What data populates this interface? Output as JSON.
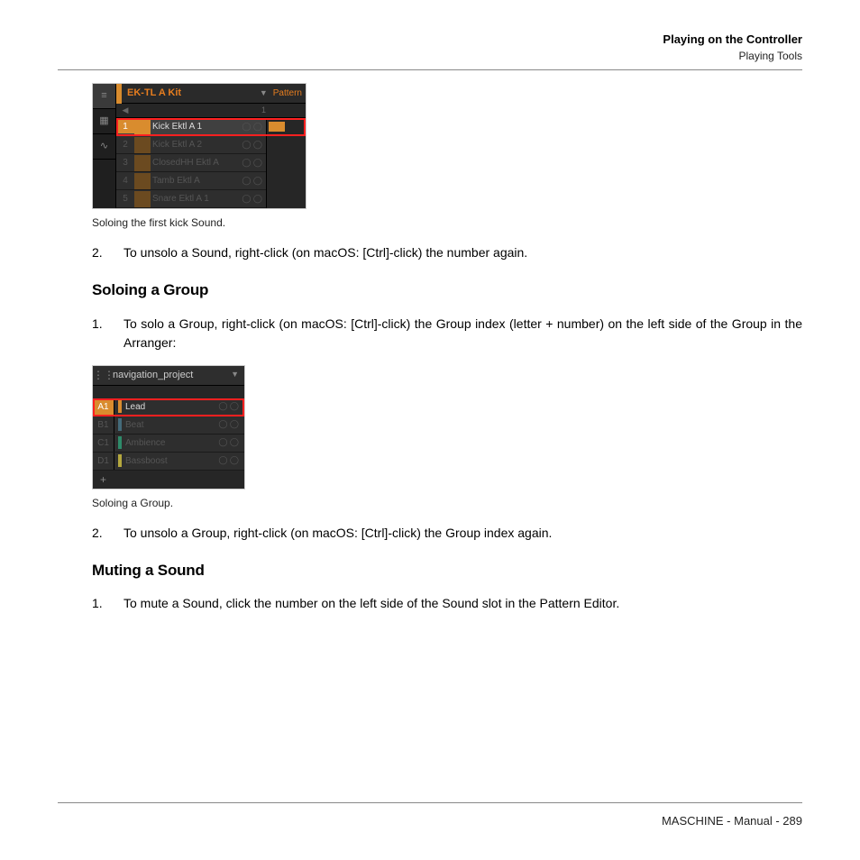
{
  "header": {
    "title": "Playing on the Controller",
    "subtitle": "Playing Tools"
  },
  "shot1": {
    "title": "EK-TL A Kit",
    "pattern_label": "Pattern",
    "pattern_num": "1",
    "rows": [
      {
        "num": "1",
        "name": "Kick Ektl A 1"
      },
      {
        "num": "2",
        "name": "Kick Ektl A 2"
      },
      {
        "num": "3",
        "name": "ClosedHH Ektl A"
      },
      {
        "num": "4",
        "name": "Tamb Ektl A"
      },
      {
        "num": "5",
        "name": "Snare Ektl A 1"
      }
    ]
  },
  "caption1": "Soloing the first kick Sound.",
  "step2a": {
    "num": "2.",
    "text": "To unsolo a Sound, right-click (on macOS: [Ctrl]-click) the number again."
  },
  "heading1": "Soloing a Group",
  "step1b": {
    "num": "1.",
    "text": "To solo a Group, right-click (on macOS: [Ctrl]-click) the Group index (letter + number) on the left side of the Group in the Arranger:"
  },
  "shot2": {
    "title": "navigation_project",
    "rows": [
      {
        "idx": "A1",
        "name": "Lead",
        "color": "#d98c2e"
      },
      {
        "idx": "B1",
        "name": "Beat",
        "color": "#446b7a"
      },
      {
        "idx": "C1",
        "name": "Ambience",
        "color": "#2e8b6a"
      },
      {
        "idx": "D1",
        "name": "Bassboost",
        "color": "#b5a83e"
      }
    ],
    "add": "+"
  },
  "caption2": "Soloing a Group.",
  "step2b": {
    "num": "2.",
    "text": "To unsolo a Group, right-click (on macOS: [Ctrl]-click) the Group index again."
  },
  "heading2": "Muting a Sound",
  "step1c": {
    "num": "1.",
    "text": "To mute a Sound, click the number on the left side of the Sound slot in the Pattern Editor."
  },
  "footer": "MASCHINE - Manual - 289"
}
